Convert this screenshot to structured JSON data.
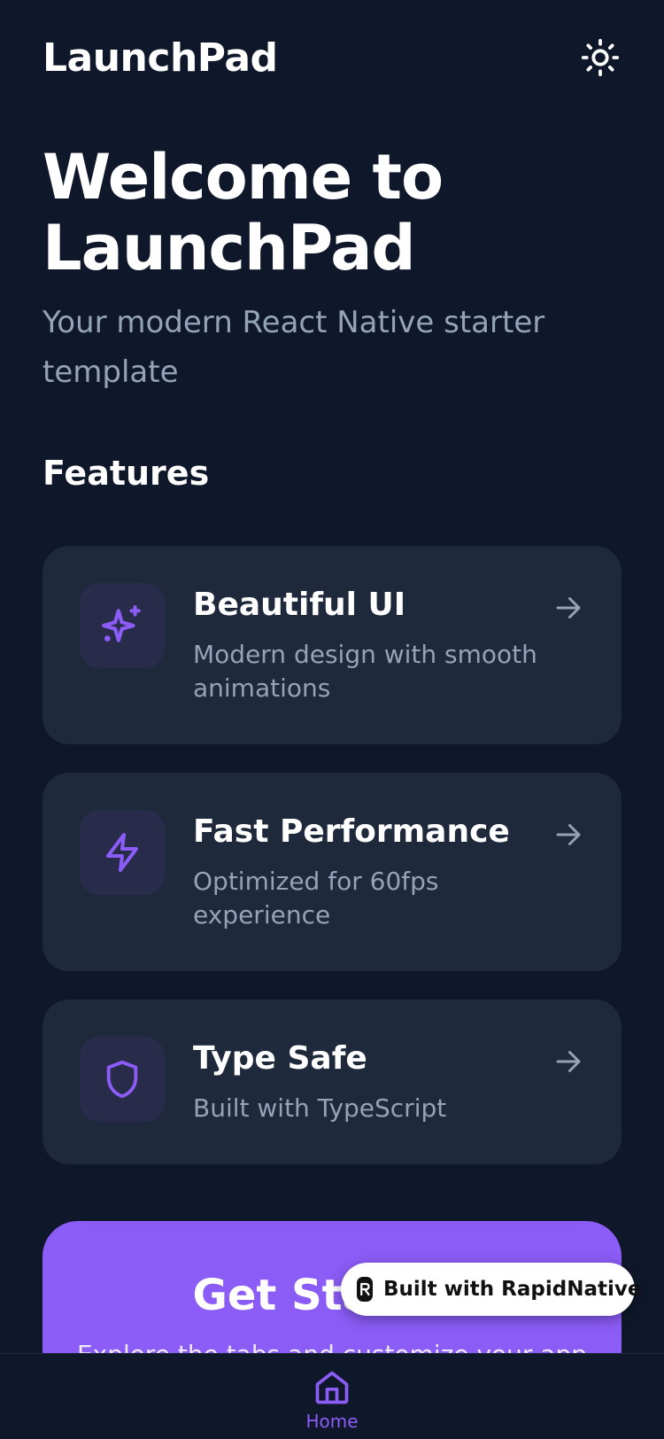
{
  "header": {
    "app_title": "LaunchPad",
    "theme_icon": "sun-icon"
  },
  "hero": {
    "title_line1": "Welcome to",
    "title_line2": "LaunchPad",
    "subtitle": "Your modern React Native starter template"
  },
  "features": {
    "section_title": "Features",
    "items": [
      {
        "title": "Beautiful UI",
        "description": "Modern design with smooth animations",
        "icon": "sparkles-icon"
      },
      {
        "title": "Fast Performance",
        "description": "Optimized for 60fps experience",
        "icon": "zap-icon"
      },
      {
        "title": "Type Safe",
        "description": "Built with TypeScript",
        "icon": "shield-icon"
      }
    ]
  },
  "cta": {
    "title": "Get Started",
    "subtitle": "Explore the tabs and customize your app"
  },
  "badge": {
    "label": "Built with RapidNative"
  },
  "tabbar": {
    "tabs": [
      {
        "label": "Home",
        "icon": "home-icon",
        "active": true
      }
    ]
  },
  "colors": {
    "background": "#0f172a",
    "card": "#1e293b",
    "accent": "#8b5cf6",
    "muted_text": "#94a3b8",
    "icon_tile": "#282c4a"
  }
}
